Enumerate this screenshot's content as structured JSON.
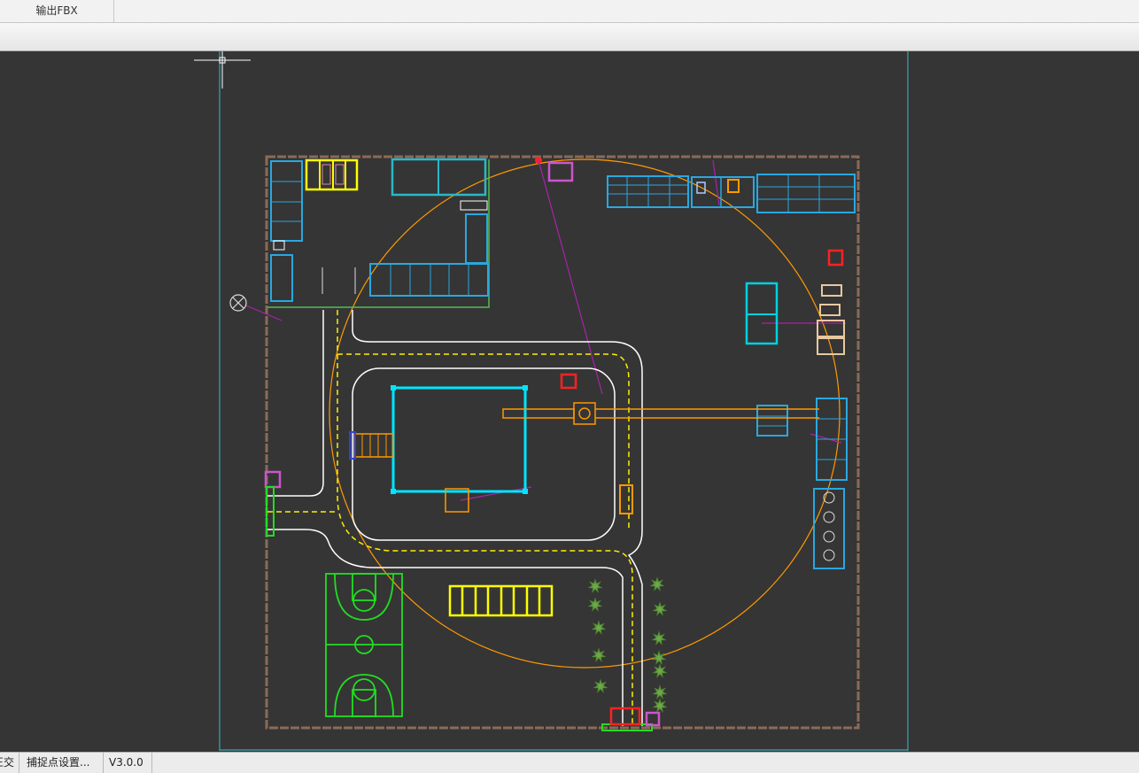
{
  "tabs": [
    {
      "label": "输出FBX"
    }
  ],
  "status": {
    "item0": "正交",
    "item1": "捕捉点设置...",
    "item2": "V3.0.0"
  },
  "colors": {
    "background": "#353535",
    "boundary": "#8b6a57",
    "road": "#ffffff",
    "road_centerline": "#ffee00",
    "yellow_parking": "#ffff00",
    "cyan_building": "#00e5ff",
    "blue_equipment": "#29a8e0",
    "green": "#22dd22",
    "orange": "#ff9900",
    "magenta": "#cc55cc",
    "red": "#ff2222",
    "viewport_frame": "#3aa6b0"
  },
  "icons": [
    "crosshair-cursor-icon",
    "north-marker-icon",
    "tree-icon"
  ]
}
